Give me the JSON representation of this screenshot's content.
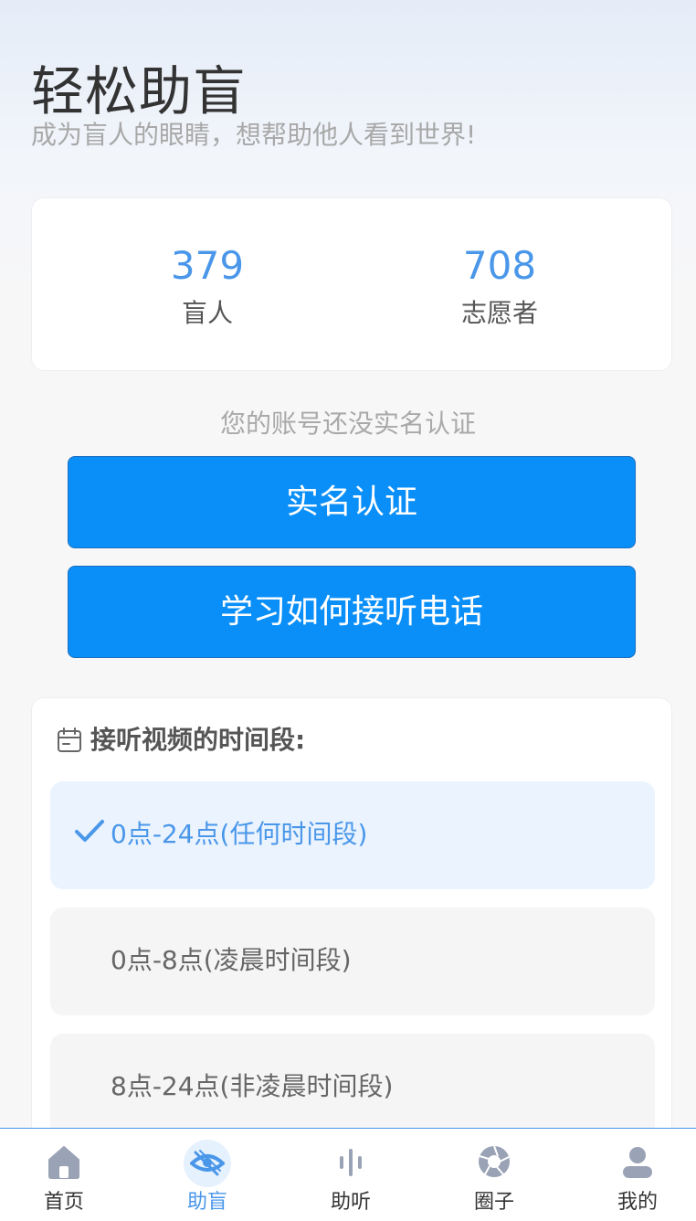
{
  "header": {
    "title": "轻松助盲",
    "subtitle": "成为盲人的眼睛，想帮助他人看到世界!"
  },
  "stats": {
    "blind": {
      "value": "379",
      "label": "盲人"
    },
    "volunteer": {
      "value": "708",
      "label": "志愿者"
    }
  },
  "verification": {
    "notice": "您的账号还没实名认证",
    "verify_button": "实名认证",
    "learn_button": "学习如何接听电话"
  },
  "time_slots": {
    "title": "接听视频的时间段:",
    "icon": "calendar-icon",
    "options": [
      {
        "label": "0点-24点(任何时间段)",
        "selected": true
      },
      {
        "label": "0点-8点(凌晨时间段)",
        "selected": false
      },
      {
        "label": "8点-24点(非凌晨时间段)",
        "selected": false
      }
    ]
  },
  "tabbar": {
    "items": [
      {
        "label": "首页",
        "icon": "home-icon",
        "active": false
      },
      {
        "label": "助盲",
        "icon": "eye-icon",
        "active": true
      },
      {
        "label": "助听",
        "icon": "audio-wave-icon",
        "active": false
      },
      {
        "label": "圈子",
        "icon": "aperture-icon",
        "active": false
      },
      {
        "label": "我的",
        "icon": "user-icon",
        "active": false
      }
    ]
  },
  "colors": {
    "accent": "#4a97ea",
    "button": "#0a8ff8",
    "selected_bg": "#eaf3fe",
    "icon_inactive": "#9aa3b5"
  }
}
